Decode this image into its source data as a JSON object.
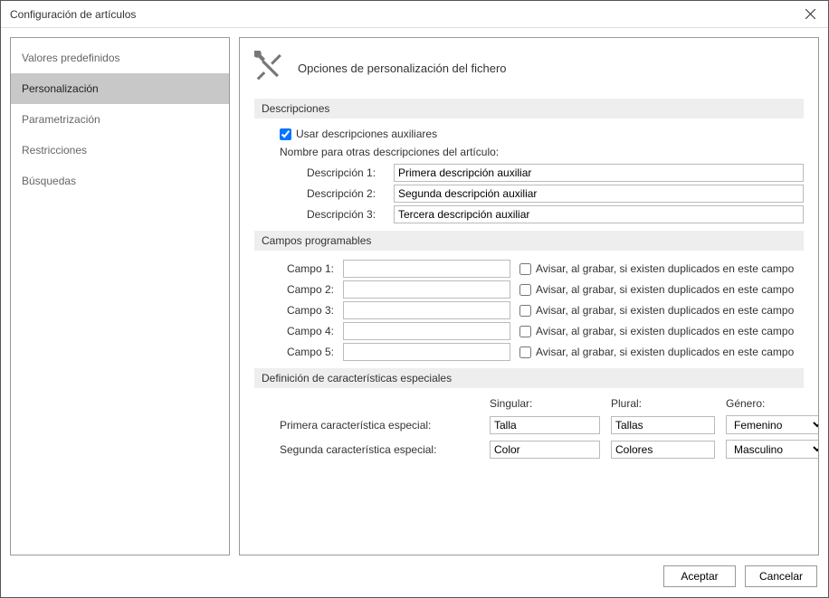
{
  "window": {
    "title": "Configuración de artículos"
  },
  "sidebar": {
    "items": [
      {
        "label": "Valores predefinidos"
      },
      {
        "label": "Personalización"
      },
      {
        "label": "Parametrización"
      },
      {
        "label": "Restricciones"
      },
      {
        "label": "Búsquedas"
      }
    ],
    "selected_index": 1
  },
  "main": {
    "header": "Opciones de personalización del fichero",
    "descripciones": {
      "section": "Descripciones",
      "checkbox_label": "Usar descripciones auxiliares",
      "checkbox_checked": true,
      "subheading": "Nombre para otras descripciones del artículo:",
      "rows": [
        {
          "label": "Descripción 1:",
          "value": "Primera descripción auxiliar"
        },
        {
          "label": "Descripción 2:",
          "value": "Segunda descripción auxiliar"
        },
        {
          "label": "Descripción 3:",
          "value": "Tercera descripción auxiliar"
        }
      ]
    },
    "campos": {
      "section": "Campos programables",
      "dup_label": "Avisar, al grabar, si existen duplicados en este campo",
      "rows": [
        {
          "label": "Campo 1:",
          "value": "",
          "check": false
        },
        {
          "label": "Campo 2:",
          "value": "",
          "check": false
        },
        {
          "label": "Campo 3:",
          "value": "",
          "check": false
        },
        {
          "label": "Campo 4:",
          "value": "",
          "check": false
        },
        {
          "label": "Campo 5:",
          "value": "",
          "check": false
        }
      ]
    },
    "especiales": {
      "section": "Definición de características especiales",
      "col_singular": "Singular:",
      "col_plural": "Plural:",
      "col_genero": "Género:",
      "rows": [
        {
          "label": "Primera característica especial:",
          "singular": "Talla",
          "plural": "Tallas",
          "genero": "Femenino"
        },
        {
          "label": "Segunda característica especial:",
          "singular": "Color",
          "plural": "Colores",
          "genero": "Masculino"
        }
      ],
      "genero_options": [
        "Femenino",
        "Masculino"
      ]
    }
  },
  "footer": {
    "accept": "Aceptar",
    "cancel": "Cancelar"
  }
}
